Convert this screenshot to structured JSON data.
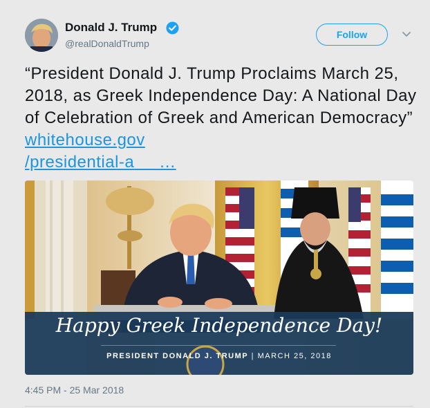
{
  "author": {
    "name": "Donald J. Trump",
    "handle": "@realDonaldTrump"
  },
  "follow_label": "Follow",
  "tweet": {
    "text": "“President Donald J. Trump Proclaims March 25, 2018, as Greek Independence Day: A National Day of Celebration of Greek and American Democracy” ",
    "link_line1": "whitehouse.gov",
    "link_line2": "/presidential-a",
    "link_ellipsis": "…"
  },
  "image": {
    "headline": "Happy Greek Independence Day!",
    "caption_name": "PRESIDENT DONALD J. TRUMP",
    "caption_sep": " | ",
    "caption_date": "MARCH 25, 2018"
  },
  "timestamp": "4:45 PM - 25 Mar 2018",
  "colors": {
    "accent": "#1da1f2",
    "link": "#1b95e0",
    "banner": "#1b3a5a"
  },
  "icons": [
    "verified-badge-icon",
    "chevron-down-icon"
  ]
}
